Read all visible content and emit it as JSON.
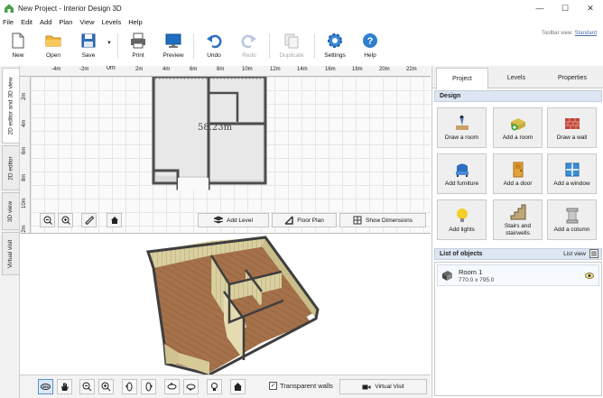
{
  "window": {
    "title": "New Project - Interior Design 3D",
    "minimize": "—",
    "maximize": "☐",
    "close": "✕"
  },
  "menu": [
    "File",
    "Edit",
    "Add",
    "Plan",
    "View",
    "Levels",
    "Help"
  ],
  "toolbar": {
    "new": "New",
    "open": "Open",
    "save": "Save",
    "print": "Print",
    "preview": "Preview",
    "undo": "Undo",
    "redo": "Redo",
    "duplicate": "Duplicate",
    "settings": "Settings",
    "help": "Help",
    "view_label": "Toolbar view:",
    "view_value": "Standard"
  },
  "left_tabs": [
    "2D editor and 3D view",
    "2D editor",
    "3D view",
    "Virtual visit"
  ],
  "ruler_top": [
    "-4m",
    "-2m",
    "0m",
    "2m",
    "4m",
    "6m",
    "8m",
    "10m",
    "12m",
    "14m",
    "16m",
    "18m",
    "20m",
    "22m"
  ],
  "ruler_left": [
    "2m",
    "4m",
    "6m",
    "8m",
    "10m",
    "12m"
  ],
  "room_area": "58.23m",
  "editor_buttons": {
    "add_level": "Add Level",
    "floor_plan": "Floor Plan",
    "show_dimensions": "Show Dimensions"
  },
  "bottom_bar": {
    "transparent_walls": "Transparent walls",
    "virtual_visit": "Virtual Visit",
    "transparent_checked": true
  },
  "right_tabs": {
    "project": "Project",
    "levels": "Levels",
    "properties": "Properties"
  },
  "design": {
    "heading": "Design",
    "buttons": [
      {
        "label": "Draw a room",
        "icon": "draw-room-icon"
      },
      {
        "label": "Add a room",
        "icon": "add-room-icon"
      },
      {
        "label": "Draw a wall",
        "icon": "draw-wall-icon"
      },
      {
        "label": "Add furniture",
        "icon": "furniture-icon"
      },
      {
        "label": "Add a door",
        "icon": "door-icon"
      },
      {
        "label": "Add a window",
        "icon": "window-icon"
      },
      {
        "label": "Add lights",
        "icon": "light-icon"
      },
      {
        "label": "Stairs and stairwells",
        "icon": "stairs-icon"
      },
      {
        "label": "Add a column",
        "icon": "column-icon"
      }
    ]
  },
  "objects": {
    "heading": "List of objects",
    "list_view": "List view",
    "items": [
      {
        "name": "Room 1",
        "size": "770.0 x 795.0"
      }
    ]
  }
}
